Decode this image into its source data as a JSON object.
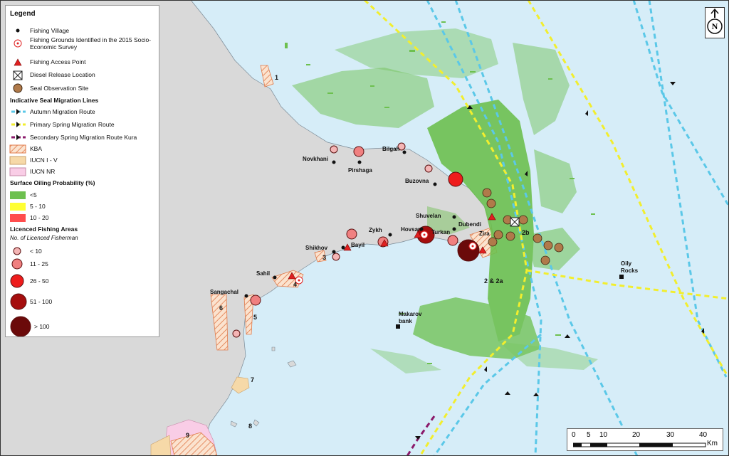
{
  "legend": {
    "title": "Legend",
    "items": {
      "fishing_village": "Fishing Village",
      "fishing_grounds": "Fishing Grounds Identified in the 2015 Socio-Economic Survey",
      "fishing_access": "Fishing Access Point",
      "diesel_release": "Diesel Release Location",
      "seal_observation": "Seal Observation Site"
    },
    "migration": {
      "heading": "Indicative Seal Migration Lines",
      "autumn": "Autumn Migration Route",
      "primary_spring": "Primary Spring Migration Route",
      "secondary_spring": "Secondary Spring Migration Route Kura"
    },
    "areas": {
      "kba": "KBA",
      "iucn_1_5": "IUCN I - V",
      "iucn_nr": "IUCN NR"
    },
    "oiling": {
      "heading": "Surface Oiling Probability (%)",
      "lt5": "<5",
      "5_10": "5 - 10",
      "10_20": "10 - 20"
    },
    "licensed": {
      "heading": "Licenced Fishing Areas",
      "subheading": "No. of Licenced Fisherman",
      "c1": "< 10",
      "c2": "11 - 25",
      "c3": "26 - 50",
      "c4": "51 - 100",
      "c5": "> 100"
    }
  },
  "places": {
    "novkhani": "Novkhani",
    "pirshaga": "Pirshaga",
    "bilgah": "Bilgah",
    "buzovna": "Buzovna",
    "shuvelan": "Shuvelan",
    "dubendi": "Dubendi",
    "zykh": "Zykh",
    "hovsan": "Hovsan",
    "turkan": "Turkan",
    "zira": "Zira",
    "shikhov": "Shikhov",
    "bayil": "Bayil",
    "sahil": "Sahil",
    "sangachal": "Sangachal",
    "makarov_bank": "Makarov bank",
    "oily_rocks": "Oily Rocks"
  },
  "area_numbers": {
    "n1": "1",
    "n2b": "2b",
    "n2_2a": "2 & 2a",
    "n3": "3",
    "n4": "4",
    "n5": "5",
    "n6": "6",
    "n7": "7",
    "n8": "8",
    "n9": "9"
  },
  "north_arrow": {
    "label": "N"
  },
  "scale_bar": {
    "ticks": [
      "0",
      "5",
      "10",
      "20",
      "30",
      "40"
    ],
    "unit": "Km"
  },
  "colors": {
    "sea": "#d6edf8",
    "land": "#d9d9d9",
    "oil_lt5": "#6dc04f",
    "oil_5_10": "#ffff33",
    "oil_10_20": "#ff4d4d",
    "autumn_route": "#5bc8e8",
    "spring_route": "#f2ee2e",
    "kura_route": "#8b1a6b",
    "kba": "#e07a4a",
    "iucn_1_5": "#f6d9a8",
    "iucn_nr": "#f9cde6"
  }
}
